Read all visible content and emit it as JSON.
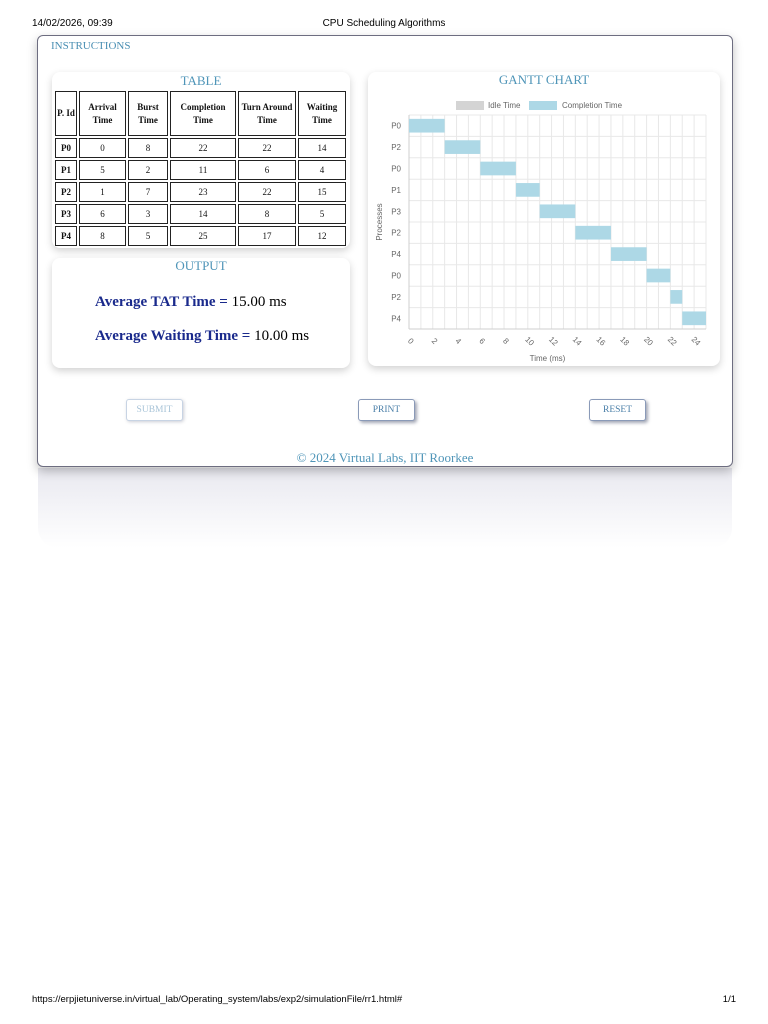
{
  "print_header": {
    "datetime": "14/02/2026, 09:39",
    "title": "CPU Scheduling Algorithms"
  },
  "print_footer": {
    "url": "https://erpjietuniverse.in/virtual_lab/Operating_system/labs/exp2/simulationFile/rr1.html#",
    "page": "1/1"
  },
  "instructions_label": "INSTRUCTIONS",
  "table": {
    "title": "TABLE",
    "headers": [
      "P. Id",
      "Arrival Time",
      "Burst Time",
      "Completion Time",
      "Turn Around Time",
      "Waiting Time"
    ],
    "rows": [
      [
        "P0",
        "0",
        "8",
        "22",
        "22",
        "14"
      ],
      [
        "P1",
        "5",
        "2",
        "11",
        "6",
        "4"
      ],
      [
        "P2",
        "1",
        "7",
        "23",
        "22",
        "15"
      ],
      [
        "P3",
        "6",
        "3",
        "14",
        "8",
        "5"
      ],
      [
        "P4",
        "8",
        "5",
        "25",
        "17",
        "12"
      ]
    ]
  },
  "output": {
    "title": "OUTPUT",
    "avg_tat_label": "Average TAT Time =",
    "avg_tat_value": "15.00 ms",
    "avg_wait_label": "Average Waiting Time =",
    "avg_wait_value": "10.00 ms"
  },
  "buttons": {
    "submit": "SUBMIT",
    "print": "PRINT",
    "reset": "RESET"
  },
  "copyright": "© 2024 Virtual Labs, IIT Roorkee",
  "colors": {
    "idle": "#d4d4d4",
    "completion": "#add8e6",
    "accent": "#4f95b8",
    "output_label": "#1a2a8c"
  },
  "chart_data": {
    "type": "bar",
    "title": "GANTT CHART",
    "xlabel": "Time (ms)",
    "ylabel": "Processes",
    "legend": [
      "Idle Time",
      "Completion Time"
    ],
    "legend_position": "top",
    "categories": [
      "P0",
      "P2",
      "P0",
      "P1",
      "P3",
      "P2",
      "P4",
      "P0",
      "P2",
      "P4"
    ],
    "series": [
      {
        "name": "Completion Time",
        "ranges": [
          [
            0,
            3
          ],
          [
            3,
            6
          ],
          [
            6,
            9
          ],
          [
            9,
            11
          ],
          [
            11,
            14
          ],
          [
            14,
            17
          ],
          [
            17,
            20
          ],
          [
            20,
            22
          ],
          [
            22,
            23
          ],
          [
            23,
            25
          ]
        ]
      }
    ],
    "xlim": [
      0,
      25
    ],
    "xticks": [
      0,
      2,
      4,
      6,
      8,
      10,
      12,
      14,
      16,
      18,
      20,
      22,
      24
    ],
    "grid": true
  }
}
